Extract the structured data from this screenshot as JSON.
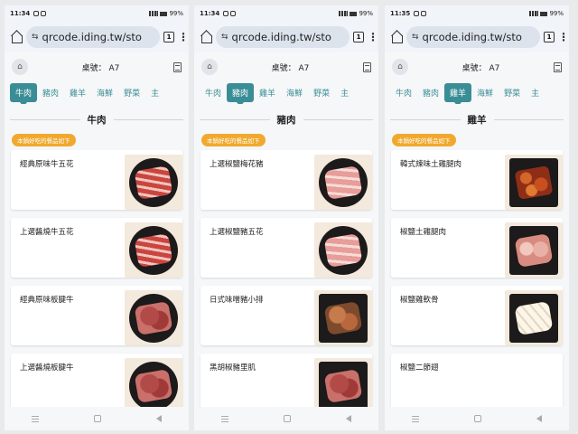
{
  "phones": [
    {
      "status": {
        "time": "11:34",
        "battery": "99%"
      },
      "url": "qrcode.iding.tw/sto",
      "tab_count": "1",
      "table_label": "桌號： A7",
      "categories": [
        "牛肉",
        "豬肉",
        "雞羊",
        "海鮮",
        "野菜",
        "主"
      ],
      "active_category": "牛肉",
      "section_title": "牛肉",
      "badge": "本鍋好吃的餐品如下",
      "items": [
        "經典原味牛五花",
        "上選醬燒牛五花",
        "經典原味板腱牛",
        "上選醬燒板腱牛"
      ]
    },
    {
      "status": {
        "time": "11:34",
        "battery": "99%"
      },
      "url": "qrcode.iding.tw/sto",
      "tab_count": "1",
      "table_label": "桌號： A7",
      "categories": [
        "牛肉",
        "豬肉",
        "雞羊",
        "海鮮",
        "野菜",
        "主"
      ],
      "active_category": "豬肉",
      "section_title": "豬肉",
      "badge": "本鍋好吃的餐品如下",
      "items": [
        "上選椒鹽梅花豬",
        "上選椒鹽豬五花",
        "日式味噌豬小排",
        "黑胡椒豬里肌"
      ]
    },
    {
      "status": {
        "time": "11:35",
        "battery": "99%"
      },
      "url": "qrcode.iding.tw/sto",
      "tab_count": "1",
      "table_label": "桌號： A7",
      "categories": [
        "牛肉",
        "豬肉",
        "雞羊",
        "海鮮",
        "野菜",
        "主"
      ],
      "active_category": "雞羊",
      "section_title": "雞羊",
      "badge": "本鍋好吃的餐品如下",
      "items": [
        "韓式辣味土雞腿肉",
        "椒鹽土雞腿肉",
        "椒鹽雞軟骨",
        "椒鹽二節翅"
      ]
    }
  ],
  "colors": {
    "accent": "#3a8d96",
    "badge": "#f0a92e"
  },
  "icons": {
    "home": "home-icon",
    "tune": "site-settings-icon",
    "menu": "kebab-icon",
    "receipt": "receipt-icon"
  }
}
